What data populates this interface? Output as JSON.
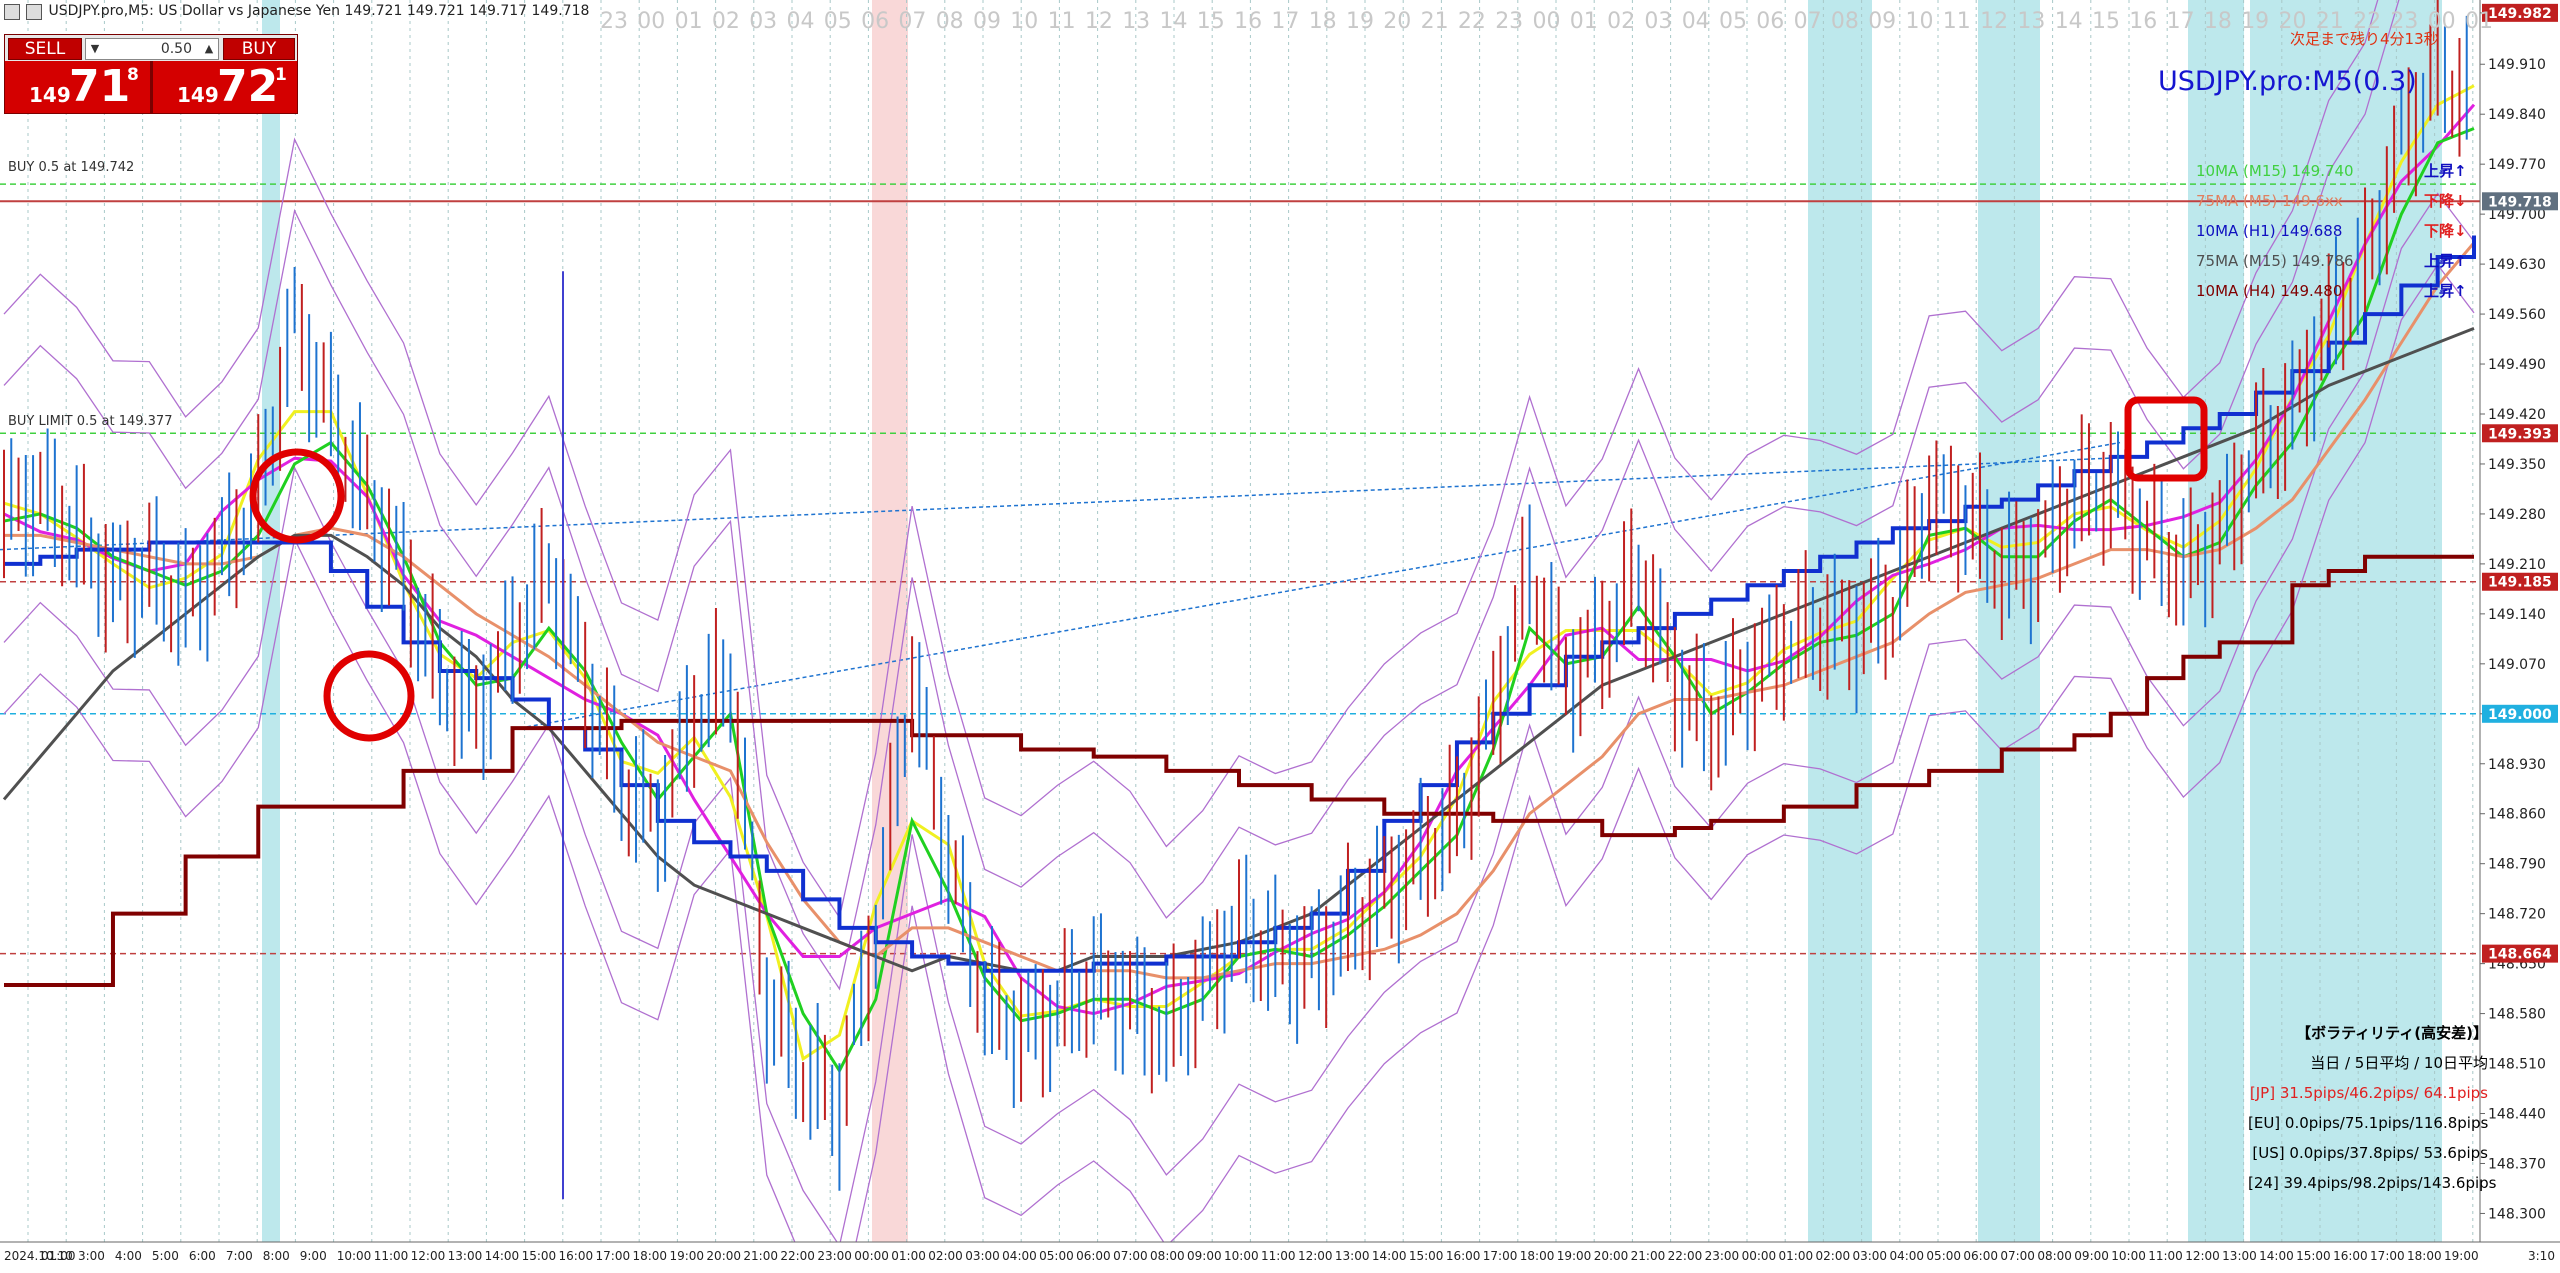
{
  "window": {
    "title": "USDJPY.pro,M5: US Dollar vs Japanese Yen  149.721 149.721 149.717 149.718"
  },
  "trade_panel": {
    "sell_label": "SELL",
    "buy_label": "BUY",
    "lot_value": "0.50",
    "sell_price_prefix": "149",
    "sell_price_big": "71",
    "sell_price_sup": "8",
    "buy_price_prefix": "149",
    "buy_price_big": "72",
    "buy_price_sup": "1"
  },
  "orders": {
    "buy_line": "BUY 0.5 at 149.742",
    "buy_limit_line": "BUY LIMIT 0.5 at 149.377"
  },
  "indicator_header": {
    "symbol_title": "USDJPY.pro:M5(0.3)",
    "countdown": "次足まで残り4分13秒"
  },
  "ma_legend": [
    {
      "label": "10MA (M15) 149.740",
      "color": "#40d040",
      "direction": "上昇↑",
      "dir_color": "#1010c0"
    },
    {
      "label": "75MA (M5) 149.6xx",
      "color": "#e08060",
      "direction": "下降↓",
      "dir_color": "#e02020"
    },
    {
      "label": "10MA (H1) 149.688",
      "color": "#1010c0",
      "direction": "下降↓",
      "dir_color": "#e02020"
    },
    {
      "label": "75MA (M15) 149.786",
      "color": "#505050",
      "direction": "上昇↑",
      "dir_color": "#1010c0"
    },
    {
      "label": "10MA (H4) 149.480",
      "color": "#800000",
      "direction": "上昇↑",
      "dir_color": "#1010c0"
    }
  ],
  "volatility_panel": {
    "title": "【ボラティリティ(高安差)】",
    "subtitle": "当日 / 5日平均 / 10日平均",
    "rows": [
      {
        "text": "[JP] 31.5pips/46.2pips/ 64.1pips",
        "color": "#e02020"
      },
      {
        "text": "[EU]  0.0pips/75.1pips/116.8pips",
        "color": "#000000"
      },
      {
        "text": "[US]  0.0pips/37.8pips/ 53.6pips",
        "color": "#000000"
      },
      {
        "text": "[24] 39.4pips/98.2pips/143.6pips",
        "color": "#000000"
      }
    ]
  },
  "price_axis": {
    "ticks": [
      "149.982",
      "149.910",
      "149.840",
      "149.770",
      "149.700",
      "149.630",
      "149.560",
      "149.490",
      "149.420",
      "149.350",
      "149.280",
      "149.210",
      "149.140",
      "149.070",
      "149.000",
      "148.930",
      "148.860",
      "148.790",
      "148.720",
      "148.650",
      "148.580",
      "148.510",
      "148.440",
      "148.370",
      "148.300"
    ],
    "tags": [
      {
        "text": "149.982",
        "color": "#c02020"
      },
      {
        "text": "149.718",
        "color": "#607080"
      },
      {
        "text": "149.393",
        "color": "#c02020"
      },
      {
        "text": "149.185",
        "color": "#c02020"
      },
      {
        "text": "149.000",
        "color": "#20b0e0"
      },
      {
        "text": "148.664",
        "color": "#c02020"
      }
    ]
  },
  "hour_ruler": [
    "23",
    "00",
    "01",
    "02",
    "03",
    "04",
    "05",
    "06",
    "07",
    "08",
    "09",
    "10",
    "11",
    "12",
    "13",
    "14",
    "15",
    "16",
    "17",
    "18",
    "19",
    "20",
    "21",
    "22",
    "23",
    "00",
    "01",
    "02",
    "03",
    "04",
    "05",
    "06",
    "07",
    "08",
    "09",
    "10",
    "11",
    "12",
    "13",
    "14",
    "15",
    "16",
    "17",
    "18",
    "19",
    "20",
    "21",
    "22",
    "23",
    "00",
    "01"
  ],
  "time_axis": {
    "labels": [
      "2024.10.10",
      "01:00",
      "3:00",
      "4:00",
      "5:00",
      "6:00",
      "7:00",
      "8:00",
      "9:00",
      "10:00",
      "11:00",
      "12:00",
      "13:00",
      "14:00",
      "15:00",
      "16:00",
      "17:00",
      "18:00",
      "19:00",
      "20:00",
      "21:00",
      "22:00",
      "23:00",
      "00:00",
      "01:00",
      "02:00",
      "03:00",
      "04:00",
      "05:00",
      "06:00",
      "07:00",
      "08:00",
      "09:00",
      "10:00",
      "11:00",
      "12:00",
      "13:00",
      "14:00",
      "15:00",
      "16:00",
      "17:00",
      "18:00",
      "19:00",
      "20:00",
      "21:00",
      "22:00",
      "23:00",
      "00:00",
      "01:00",
      "02:00",
      "03:00",
      "04:00",
      "05:00",
      "06:00",
      "07:00",
      "08:00",
      "09:00",
      "10:00",
      "11:00",
      "12:00",
      "13:00",
      "14:00",
      "15:00",
      "16:00",
      "17:00",
      "18:00",
      "19:00"
    ],
    "corner": "3:10"
  },
  "chart_data": {
    "type": "line",
    "ylim": [
      148.26,
      150.0
    ],
    "y_ticks": [
      149.982,
      149.91,
      149.84,
      149.77,
      149.7,
      149.63,
      149.56,
      149.49,
      149.42,
      149.35,
      149.28,
      149.21,
      149.14,
      149.07,
      149.0,
      148.93,
      148.86,
      148.79,
      148.72,
      148.65,
      148.58,
      148.51,
      148.44,
      148.37,
      148.3
    ],
    "series": [
      {
        "name": "Price",
        "color": "#1e73d0",
        "values": [
          149.28,
          149.31,
          149.25,
          149.18,
          149.2,
          149.15,
          149.22,
          149.3,
          149.55,
          149.42,
          149.3,
          149.2,
          149.05,
          149.0,
          149.1,
          149.2,
          149.05,
          148.9,
          148.85,
          149.0,
          149.05,
          148.6,
          148.5,
          148.45,
          148.7,
          149.05,
          148.8,
          148.6,
          148.55,
          148.58,
          148.62,
          148.6,
          148.55,
          148.62,
          148.7,
          148.66,
          148.65,
          148.7,
          148.75,
          148.8,
          148.85,
          149.0,
          149.2,
          149.05,
          149.1,
          149.2,
          149.05,
          148.98,
          149.05,
          149.1,
          149.12,
          149.12,
          149.15,
          149.3,
          149.28,
          149.2,
          149.22,
          149.3,
          149.32,
          149.25,
          149.2,
          149.25,
          149.36,
          149.42,
          149.55,
          149.62,
          149.8,
          149.9,
          149.86
        ]
      },
      {
        "name": "10MA (M15)",
        "color": "#20d020",
        "values": [
          149.27,
          149.28,
          149.26,
          149.22,
          149.2,
          149.18,
          149.2,
          149.25,
          149.35,
          149.38,
          149.32,
          149.22,
          149.1,
          149.04,
          149.05,
          149.12,
          149.06,
          148.96,
          148.88,
          148.94,
          149.0,
          148.72,
          148.58,
          148.5,
          148.6,
          148.85,
          148.75,
          148.63,
          148.57,
          148.58,
          148.6,
          148.6,
          148.58,
          148.6,
          148.66,
          148.67,
          148.66,
          148.69,
          148.73,
          148.78,
          148.83,
          148.95,
          149.12,
          149.07,
          149.08,
          149.15,
          149.08,
          149.0,
          149.03,
          149.07,
          149.1,
          149.11,
          149.14,
          149.25,
          149.26,
          149.22,
          149.22,
          149.27,
          149.3,
          149.26,
          149.22,
          149.24,
          149.32,
          149.38,
          149.48,
          149.56,
          149.7,
          149.8,
          149.82
        ]
      },
      {
        "name": "75MA (M5)",
        "color": "#e8906a",
        "values": [
          149.25,
          149.25,
          149.24,
          149.23,
          149.22,
          149.21,
          149.21,
          149.22,
          149.25,
          149.26,
          149.25,
          149.22,
          149.18,
          149.14,
          149.11,
          149.08,
          149.04,
          149.0,
          148.96,
          148.94,
          148.92,
          148.82,
          148.74,
          148.68,
          148.66,
          148.7,
          148.7,
          148.68,
          148.66,
          148.64,
          148.64,
          148.64,
          148.63,
          148.63,
          148.64,
          148.65,
          148.65,
          148.66,
          148.67,
          148.69,
          148.72,
          148.78,
          148.86,
          148.9,
          148.94,
          149.0,
          149.02,
          149.02,
          149.03,
          149.04,
          149.06,
          149.08,
          149.1,
          149.14,
          149.17,
          149.18,
          149.19,
          149.21,
          149.23,
          149.23,
          149.22,
          149.23,
          149.26,
          149.3,
          149.37,
          149.44,
          149.52,
          149.6,
          149.66
        ]
      },
      {
        "name": "75MA (M15)",
        "color": "#505050",
        "values": [
          148.88,
          148.94,
          149.0,
          149.06,
          149.1,
          149.14,
          149.18,
          149.22,
          149.25,
          149.25,
          149.22,
          149.18,
          149.12,
          149.08,
          149.02,
          148.98,
          148.92,
          148.86,
          148.8,
          148.76,
          148.74,
          148.72,
          148.7,
          148.68,
          148.66,
          148.64,
          148.66,
          148.65,
          148.64,
          148.64,
          148.66,
          148.66,
          148.66,
          148.67,
          148.68,
          148.7,
          148.72,
          148.76,
          148.8,
          148.84,
          148.88,
          148.92,
          148.96,
          149.0,
          149.04,
          149.06,
          149.08,
          149.1,
          149.12,
          149.14,
          149.16,
          149.18,
          149.2,
          149.22,
          149.24,
          149.26,
          149.28,
          149.3,
          149.32,
          149.34,
          149.36,
          149.38,
          149.4,
          149.43,
          149.46,
          149.48,
          149.5,
          149.52,
          149.54
        ]
      },
      {
        "name": "10MA (H1)",
        "color": "#1030d0",
        "values": [
          149.21,
          149.22,
          149.23,
          149.23,
          149.24,
          149.24,
          149.24,
          149.24,
          149.24,
          149.2,
          149.15,
          149.1,
          149.06,
          149.05,
          149.02,
          148.98,
          148.95,
          148.9,
          148.85,
          148.82,
          148.8,
          148.78,
          148.74,
          148.7,
          148.68,
          148.66,
          148.65,
          148.64,
          148.64,
          148.64,
          148.65,
          148.65,
          148.66,
          148.66,
          148.68,
          148.7,
          148.72,
          148.78,
          148.85,
          148.9,
          148.96,
          149.0,
          149.04,
          149.08,
          149.1,
          149.12,
          149.14,
          149.16,
          149.18,
          149.2,
          149.22,
          149.24,
          149.26,
          149.27,
          149.29,
          149.3,
          149.32,
          149.34,
          149.36,
          149.38,
          149.4,
          149.42,
          149.45,
          149.48,
          149.52,
          149.56,
          149.6,
          149.64,
          149.67
        ]
      },
      {
        "name": "10MA (H4)",
        "color": "#800000",
        "values": [
          148.62,
          148.62,
          148.62,
          148.72,
          148.72,
          148.8,
          148.8,
          148.87,
          148.87,
          148.87,
          148.87,
          148.92,
          148.92,
          148.92,
          148.98,
          148.98,
          148.98,
          148.99,
          148.99,
          148.99,
          148.99,
          148.99,
          148.99,
          148.99,
          148.99,
          148.97,
          148.97,
          148.97,
          148.95,
          148.95,
          148.94,
          148.94,
          148.92,
          148.92,
          148.9,
          148.9,
          148.88,
          148.88,
          148.86,
          148.86,
          148.86,
          148.85,
          148.85,
          148.85,
          148.83,
          148.83,
          148.84,
          148.85,
          148.85,
          148.87,
          148.87,
          148.9,
          148.9,
          148.92,
          148.92,
          148.95,
          148.95,
          148.97,
          149.0,
          149.05,
          149.08,
          149.1,
          149.1,
          149.18,
          149.2,
          149.22,
          149.22,
          149.22,
          149.22
        ]
      }
    ],
    "horizontal_levels": [
      {
        "value": 149.742,
        "color": "#40d040",
        "style": "dashed"
      },
      {
        "value": 149.718,
        "color": "#c04040",
        "style": "solid"
      },
      {
        "value": 149.393,
        "color": "#40d040",
        "style": "dashed"
      },
      {
        "value": 149.185,
        "color": "#c04040",
        "style": "dashed"
      },
      {
        "value": 149.0,
        "color": "#20b0e0",
        "style": "dashed"
      },
      {
        "value": 148.664,
        "color": "#c04040",
        "style": "dashed"
      }
    ]
  },
  "annotations": [
    {
      "type": "circle",
      "color": "#e00000"
    },
    {
      "type": "circle",
      "color": "#e00000"
    },
    {
      "type": "rounded-square",
      "color": "#e00000"
    }
  ],
  "colors": {
    "session_band": "#b6e6ea",
    "session_band_pink": "#f8d4d4",
    "bollinger": "#b070d0",
    "magenta_line": "#e020e0",
    "yellow_line": "#f0f020"
  }
}
